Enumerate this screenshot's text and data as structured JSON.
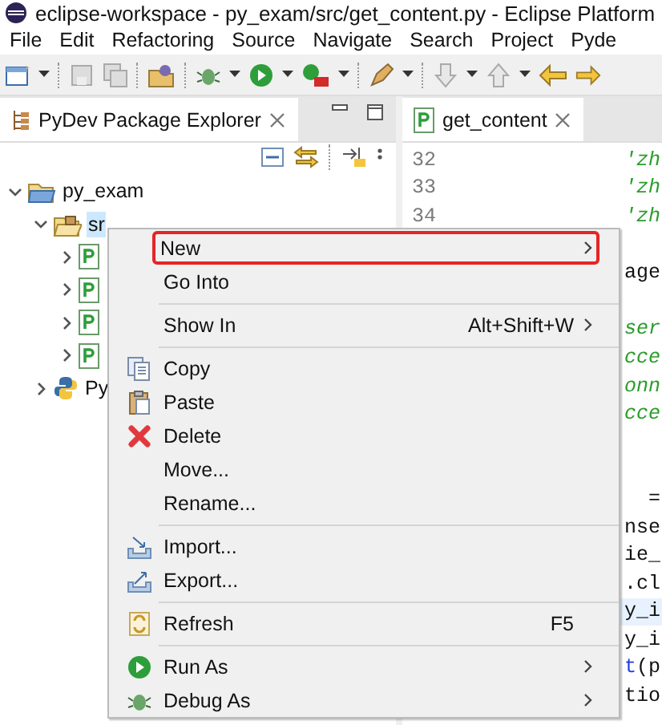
{
  "window": {
    "title": "eclipse-workspace - py_exam/src/get_content.py - Eclipse Platform"
  },
  "menubar": [
    "File",
    "Edit",
    "Refactoring",
    "Source",
    "Navigate",
    "Search",
    "Project",
    "Pyde"
  ],
  "explorer": {
    "tab": {
      "label": "PyDev Package Explorer",
      "selected": true
    },
    "tree": [
      {
        "kind": "project",
        "label": "py_exam",
        "expanded": true,
        "selected": false,
        "children": [
          {
            "kind": "source-folder",
            "label": "sr",
            "expanded": true,
            "selected": true,
            "children": [
              {
                "kind": "file",
                "expanded": false,
                "selected": false
              },
              {
                "kind": "file",
                "expanded": false,
                "selected": false
              },
              {
                "kind": "file",
                "expanded": false,
                "selected": false
              },
              {
                "kind": "file",
                "expanded": false,
                "selected": false
              }
            ]
          },
          {
            "kind": "interpreter",
            "label": "Py",
            "expanded": false,
            "selected": false
          }
        ]
      }
    ]
  },
  "editor": {
    "tab": {
      "label": "get_content",
      "selected": true
    },
    "lines": [
      {
        "number": "32",
        "highlighted": false,
        "parts": [
          {
            "text": "'zh",
            "kind": "string"
          }
        ]
      },
      {
        "number": "33",
        "highlighted": false,
        "parts": [
          {
            "text": "'zh",
            "kind": "string"
          }
        ]
      },
      {
        "number": "34",
        "highlighted": false,
        "parts": [
          {
            "text": "'zh",
            "kind": "string"
          }
        ]
      },
      {
        "highlighted": false
      },
      {
        "highlighted": false,
        "parts": [
          {
            "text": "age",
            "kind": "plain"
          }
        ]
      },
      {
        "highlighted": false
      },
      {
        "highlighted": false,
        "parts": [
          {
            "text": "ser",
            "kind": "comment"
          }
        ]
      },
      {
        "highlighted": false,
        "parts": [
          {
            "text": "cce",
            "kind": "comment"
          }
        ]
      },
      {
        "highlighted": false,
        "parts": [
          {
            "text": "onn",
            "kind": "comment"
          }
        ]
      },
      {
        "highlighted": false,
        "parts": [
          {
            "text": "cce",
            "kind": "comment"
          }
        ]
      },
      {
        "highlighted": false
      },
      {
        "highlighted": false
      },
      {
        "highlighted": false,
        "parts": [
          {
            "text": "=",
            "kind": "plain"
          }
        ]
      },
      {
        "highlighted": false,
        "parts": [
          {
            "text": "nse",
            "kind": "plain"
          }
        ]
      },
      {
        "highlighted": false,
        "parts": [
          {
            "text": "ie_",
            "kind": "plain"
          }
        ]
      },
      {
        "highlighted": false,
        "parts": [
          {
            "text": ".cl",
            "kind": "plain"
          }
        ]
      },
      {
        "highlighted": true,
        "parts": [
          {
            "text": "y_i",
            "kind": "plain"
          }
        ]
      },
      {
        "highlighted": false,
        "parts": [
          {
            "text": "y_i",
            "kind": "plain"
          }
        ]
      },
      {
        "highlighted": false,
        "parts": [
          {
            "text": "t",
            "kind": "call"
          },
          {
            "text": "(p",
            "kind": "plain"
          }
        ]
      },
      {
        "highlighted": false,
        "parts": [
          {
            "text": "tio",
            "kind": "plain"
          }
        ]
      }
    ]
  },
  "context_menu": [
    {
      "kind": "plain",
      "label": "New",
      "selected": true,
      "submenu": true
    },
    {
      "kind": "plain",
      "label": "Go Into",
      "selected": false,
      "submenu": false
    },
    {
      "kind": "separator"
    },
    {
      "kind": "plain",
      "label": "Show In",
      "shortcut": "Alt+Shift+W",
      "selected": false,
      "submenu": true
    },
    {
      "kind": "separator"
    },
    {
      "kind": "copy",
      "label": "Copy",
      "selected": false,
      "submenu": false
    },
    {
      "kind": "paste",
      "label": "Paste",
      "selected": false,
      "submenu": false
    },
    {
      "kind": "delete",
      "label": "Delete",
      "selected": false,
      "submenu": false
    },
    {
      "kind": "plain",
      "label": "Move...",
      "selected": false,
      "submenu": false
    },
    {
      "kind": "plain",
      "label": "Rename...",
      "selected": false,
      "submenu": false
    },
    {
      "kind": "separator"
    },
    {
      "kind": "import",
      "label": "Import...",
      "selected": false,
      "submenu": false
    },
    {
      "kind": "export",
      "label": "Export...",
      "selected": false,
      "submenu": false
    },
    {
      "kind": "separator"
    },
    {
      "kind": "refresh",
      "label": "Refresh",
      "shortcut": "F5",
      "selected": false,
      "submenu": false
    },
    {
      "kind": "separator"
    },
    {
      "kind": "run",
      "label": "Run As",
      "selected": false,
      "submenu": true
    },
    {
      "kind": "debug",
      "label": "Debug As",
      "selected": false,
      "submenu": true
    }
  ]
}
